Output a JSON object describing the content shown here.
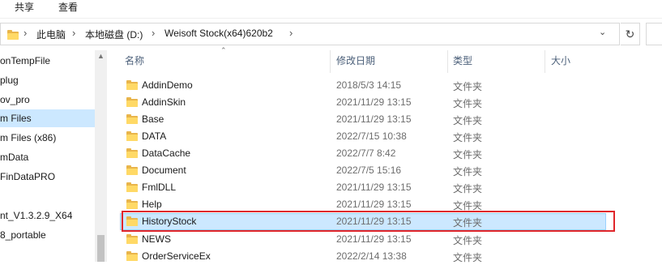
{
  "ribbon": {
    "tabs": [
      "共享",
      "查看"
    ]
  },
  "address": {
    "crumbs": [
      "此电脑",
      "本地磁盘 (D:)",
      "Weisoft Stock(x64)620b2"
    ],
    "separator": "›",
    "dropdown_icon": "chevron-down-icon",
    "refresh_glyph": "↻"
  },
  "nav": {
    "items": [
      "onTempFile",
      "plug",
      "ov_pro",
      "m Files",
      "m Files (x86)",
      "mData",
      "FinDataPRO",
      "",
      "nt_V1.3.2.9_X64",
      "8_portable"
    ],
    "selected_index": 3
  },
  "columns": {
    "name": "名称",
    "modified": "修改日期",
    "type": "类型",
    "size": "大小"
  },
  "files": [
    {
      "name": "AddinDemo",
      "modified": "2018/5/3 14:15",
      "type": "文件夹"
    },
    {
      "name": "AddinSkin",
      "modified": "2021/11/29 13:15",
      "type": "文件夹"
    },
    {
      "name": "Base",
      "modified": "2021/11/29 13:15",
      "type": "文件夹"
    },
    {
      "name": "DATA",
      "modified": "2022/7/15 10:38",
      "type": "文件夹"
    },
    {
      "name": "DataCache",
      "modified": "2022/7/7 8:42",
      "type": "文件夹"
    },
    {
      "name": "Document",
      "modified": "2022/7/5 15:16",
      "type": "文件夹"
    },
    {
      "name": "FmlDLL",
      "modified": "2021/11/29 13:15",
      "type": "文件夹"
    },
    {
      "name": "Help",
      "modified": "2021/11/29 13:15",
      "type": "文件夹"
    },
    {
      "name": "HistoryStock",
      "modified": "2021/11/29 13:15",
      "type": "文件夹"
    },
    {
      "name": "NEWS",
      "modified": "2021/11/29 13:15",
      "type": "文件夹"
    },
    {
      "name": "OrderServiceEx",
      "modified": "2022/2/14 13:38",
      "type": "文件夹"
    }
  ],
  "selected_file": "HistoryStock",
  "colors": {
    "selection": "#cce8ff",
    "highlight_border": "#e0262b",
    "folder": "#ffd966"
  }
}
